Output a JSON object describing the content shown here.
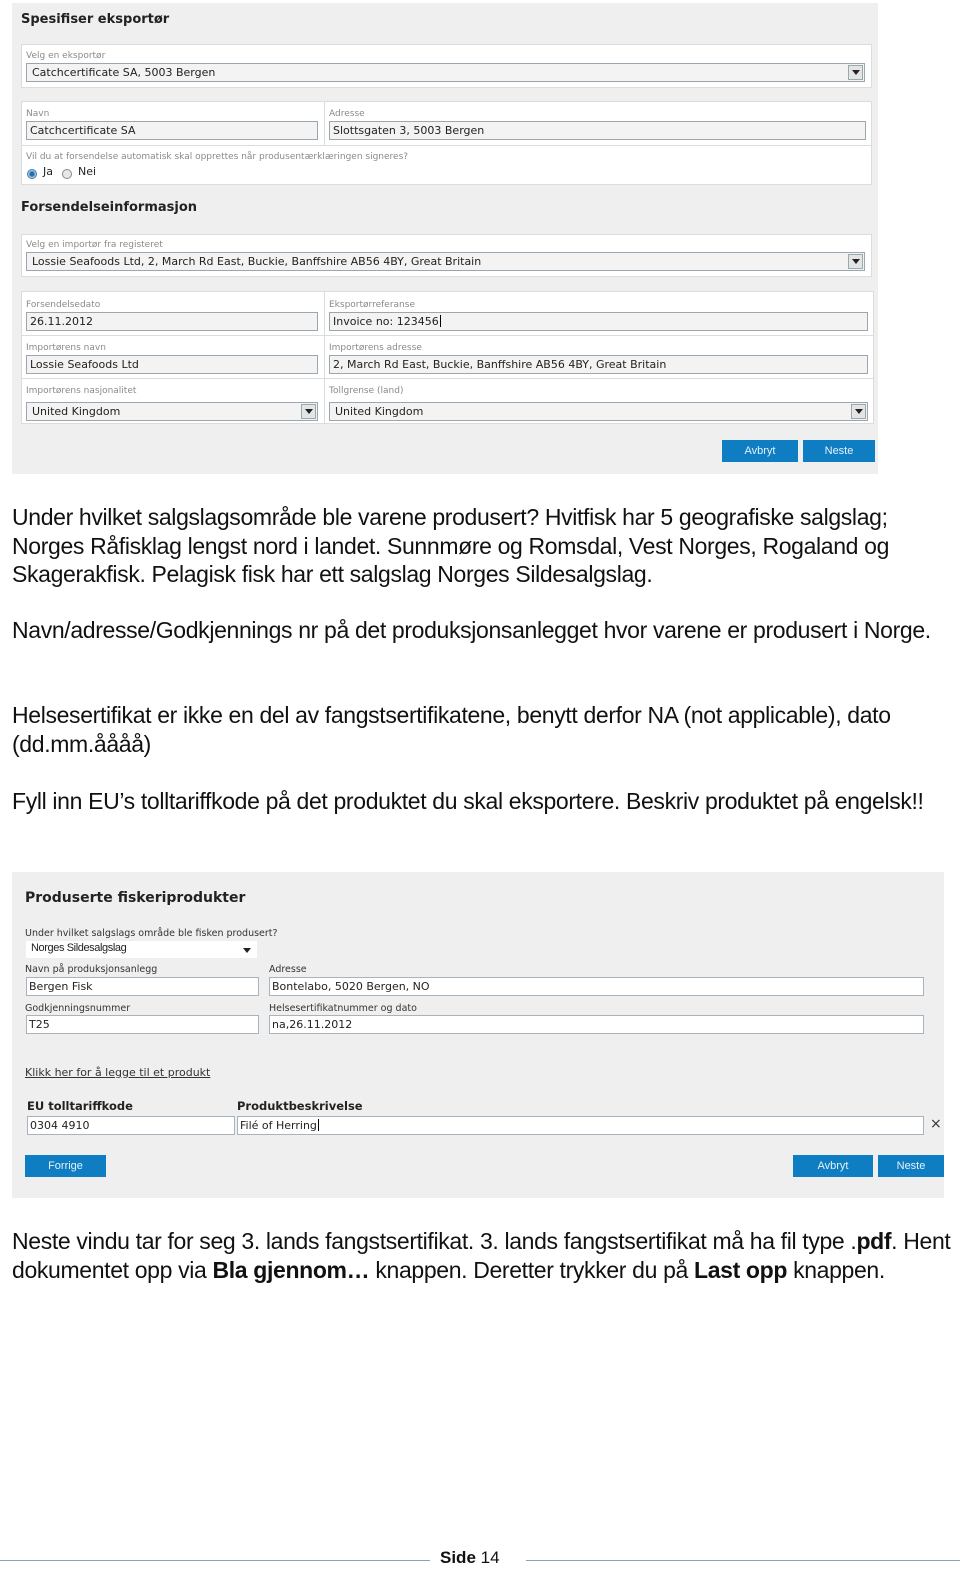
{
  "exporter_form": {
    "title": "Spesifiser eksportør",
    "exporter_select": {
      "label": "Velg en eksportør",
      "value": "Catchcertificate SA, 5003 Bergen"
    },
    "name": {
      "label": "Navn",
      "value": "Catchcertificate SA"
    },
    "address": {
      "label": "Adresse",
      "value": "Slottsgaten 3, 5003 Bergen"
    },
    "auto_shipment": {
      "question": "Vil du at forsendelse automatisk skal opprettes når produsentærklæringen signeres?",
      "options": [
        {
          "label": "Ja",
          "selected": true
        },
        {
          "label": "Nei",
          "selected": false
        }
      ]
    },
    "shipment_title": "Forsendelseinformasjon",
    "importer_select": {
      "label": "Velg en importør fra registeret",
      "value": "Lossie Seafoods Ltd, 2, March Rd East, Buckie, Banffshire AB56 4BY, Great Britain"
    },
    "shipment_date": {
      "label": "Forsendelsedato",
      "value": "26.11.2012"
    },
    "exporter_reference": {
      "label": "Eksportørreferanse",
      "value": "Invoice no: 123456"
    },
    "importer_name": {
      "label": "Importørens navn",
      "value": "Lossie Seafoods Ltd"
    },
    "importer_address": {
      "label": "Importørens adresse",
      "value": "2, March Rd East, Buckie, Banffshire AB56 4BY, Great Britain"
    },
    "importer_nationality": {
      "label": "Importørens nasjonalitet",
      "value": "United Kingdom"
    },
    "customs_border": {
      "label": "Tollgrense (land)",
      "value": "United Kingdom"
    },
    "cancel_label": "Avbryt",
    "next_label": "Neste"
  },
  "paragraphs": {
    "p1": "Under hvilket salgslagsområde ble varene produsert? Hvitfisk har 5 geografiske salgslag; Norges Råfisklag lengst nord i landet. Sunnmøre og Romsdal, Vest Norges, Rogaland og Skagerakfisk. Pelagisk fisk har ett salgslag Norges Sildesalgslag.",
    "p2": "Navn/adresse/Godkjennings nr på det produksjonsanlegget hvor varene er produsert i Norge.",
    "p3": "Helsesertifikat er ikke en del av fangstsertifikatene, benytt derfor NA (not applicable), dato (dd.mm.åååå)",
    "p4": "Fyll inn EU’s tolltariffkode på det produktet du skal eksportere. Beskriv produktet på engelsk!!",
    "p5": {
      "t1": "Neste vindu tar for seg 3. lands fangstsertifikat. 3. lands fangstsertifikat må ha fil type .",
      "b1": "pdf",
      "t2": ". Hent dokumentet opp via ",
      "b2": "Bla gjennom…",
      "t3": " knappen. Deretter trykker du på ",
      "b3": "Last opp",
      "t4": " knappen."
    }
  },
  "products_form": {
    "title": "Produserte fiskeriprodukter",
    "sales_area": {
      "label": "Under hvilket salgslags område ble fisken produsert?",
      "value": "Norges Sildesalgslag"
    },
    "plant_name": {
      "label": "Navn på produksjonsanlegg",
      "value": "Bergen Fisk"
    },
    "address": {
      "label": "Adresse",
      "value": "Bontelabo, 5020 Bergen, NO"
    },
    "approval_number": {
      "label": "Godkjenningsnummer",
      "value": "T25"
    },
    "health_cert": {
      "label": "Helsesertifikatnummer og dato",
      "value": "na,26.11.2012"
    },
    "add_product_link": "Klikk her for å legge til et produkt",
    "tariff_code": {
      "label": "EU tolltariffkode",
      "value": "0304 4910"
    },
    "product_description": {
      "label": "Produktbeskrivelse",
      "value": "Filé of Herring"
    },
    "remove_icon": "×",
    "previous_label": "Forrige",
    "cancel_label": "Avbryt",
    "next_label": "Neste"
  },
  "footer": {
    "page_prefix": "Side",
    "page_number": "14"
  },
  "colors": {
    "button_blue": "#0e7dc2",
    "panel_gray": "#efefef"
  }
}
